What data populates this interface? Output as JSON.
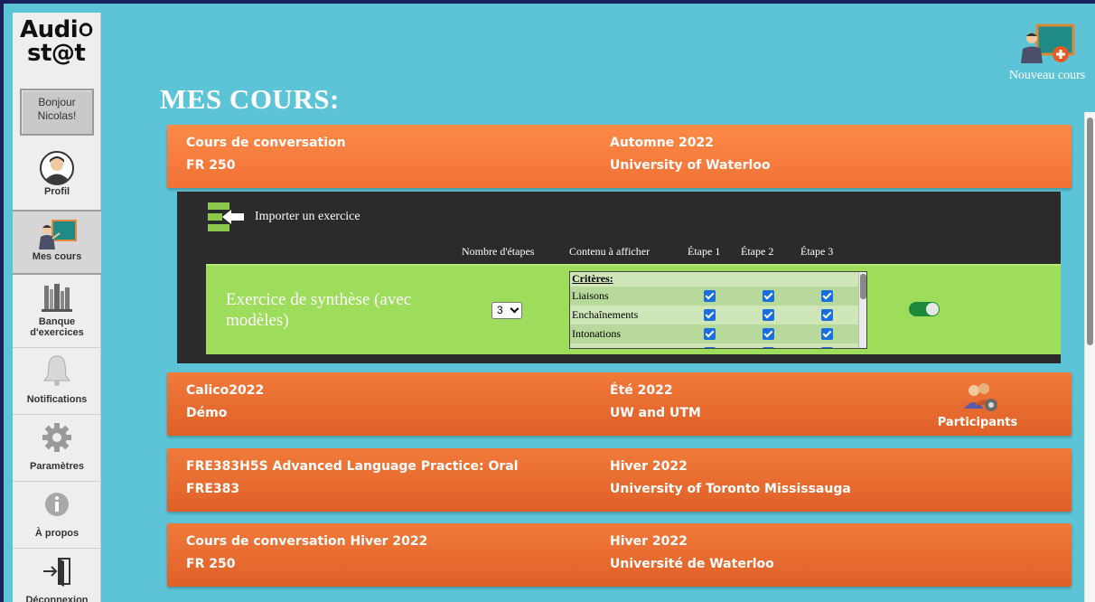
{
  "app": {
    "logo_line1": "Audi",
    "logo_line1_tail": "o",
    "logo_line2": "st@t",
    "greeting_line1": "Bonjour",
    "greeting_line2": "Nicolas!"
  },
  "sidebar": {
    "items": [
      {
        "label": "Profil",
        "icon": "profile-avatar-icon",
        "active": false
      },
      {
        "label": "Mes cours",
        "icon": "teacher-board-icon",
        "active": true
      },
      {
        "label_line1": "Banque",
        "label_line2": "d'exercices",
        "icon": "bookshelf-icon",
        "active": false
      },
      {
        "label": "Notifications",
        "icon": "bell-icon",
        "active": false
      },
      {
        "label": "Paramètres",
        "icon": "gear-icon",
        "active": false
      },
      {
        "label": "À propos",
        "icon": "info-icon",
        "active": false
      },
      {
        "label": "Déconnexion",
        "icon": "logout-door-icon",
        "active": false
      }
    ]
  },
  "header": {
    "title": "MES COURS:",
    "new_course_label": "Nouveau cours"
  },
  "courses": [
    {
      "name": "Cours de conversation",
      "code": "FR 250",
      "term": "Automne 2022",
      "institution": "University of Waterloo",
      "expanded": true
    },
    {
      "name": "Calico2022",
      "code": "Démo",
      "term": "Été 2022",
      "institution": "UW and UTM",
      "participants_label": "Participants"
    },
    {
      "name": "FRE383H5S Advanced Language Practice: Oral",
      "code": "FRE383",
      "term": "Hiver 2022",
      "institution": "University of Toronto Mississauga"
    },
    {
      "name": "Cours de conversation Hiver 2022",
      "code": "FR 250",
      "term": "Hiver 2022",
      "institution": "Université de Waterloo"
    }
  ],
  "exercise_panel": {
    "import_label": "Importer un exercice",
    "columns": {
      "steps": "Nombre d'étapes",
      "content": "Contenu à afficher",
      "step1": "Étape 1",
      "step2": "Étape 2",
      "step3": "Étape 3"
    },
    "exercise": {
      "name": "Exercice de synthèse (avec modèles)",
      "steps_selected": "3",
      "criteria_header": "Critères:",
      "criteria": [
        {
          "label": "Liaisons",
          "step1": true,
          "step2": true,
          "step3": true
        },
        {
          "label": "Enchaînements",
          "step1": true,
          "step2": true,
          "step3": true
        },
        {
          "label": "Intonations",
          "step1": true,
          "step2": true,
          "step3": true
        }
      ],
      "enabled": true
    }
  },
  "colors": {
    "background": "#5cc4d6",
    "card_orange": "#e86a2e",
    "panel_dark": "#2b2b2b",
    "exercise_green": "#9edc5c",
    "toggle_on": "#1c8a3a",
    "checkbox_blue": "#1a6fe0"
  }
}
